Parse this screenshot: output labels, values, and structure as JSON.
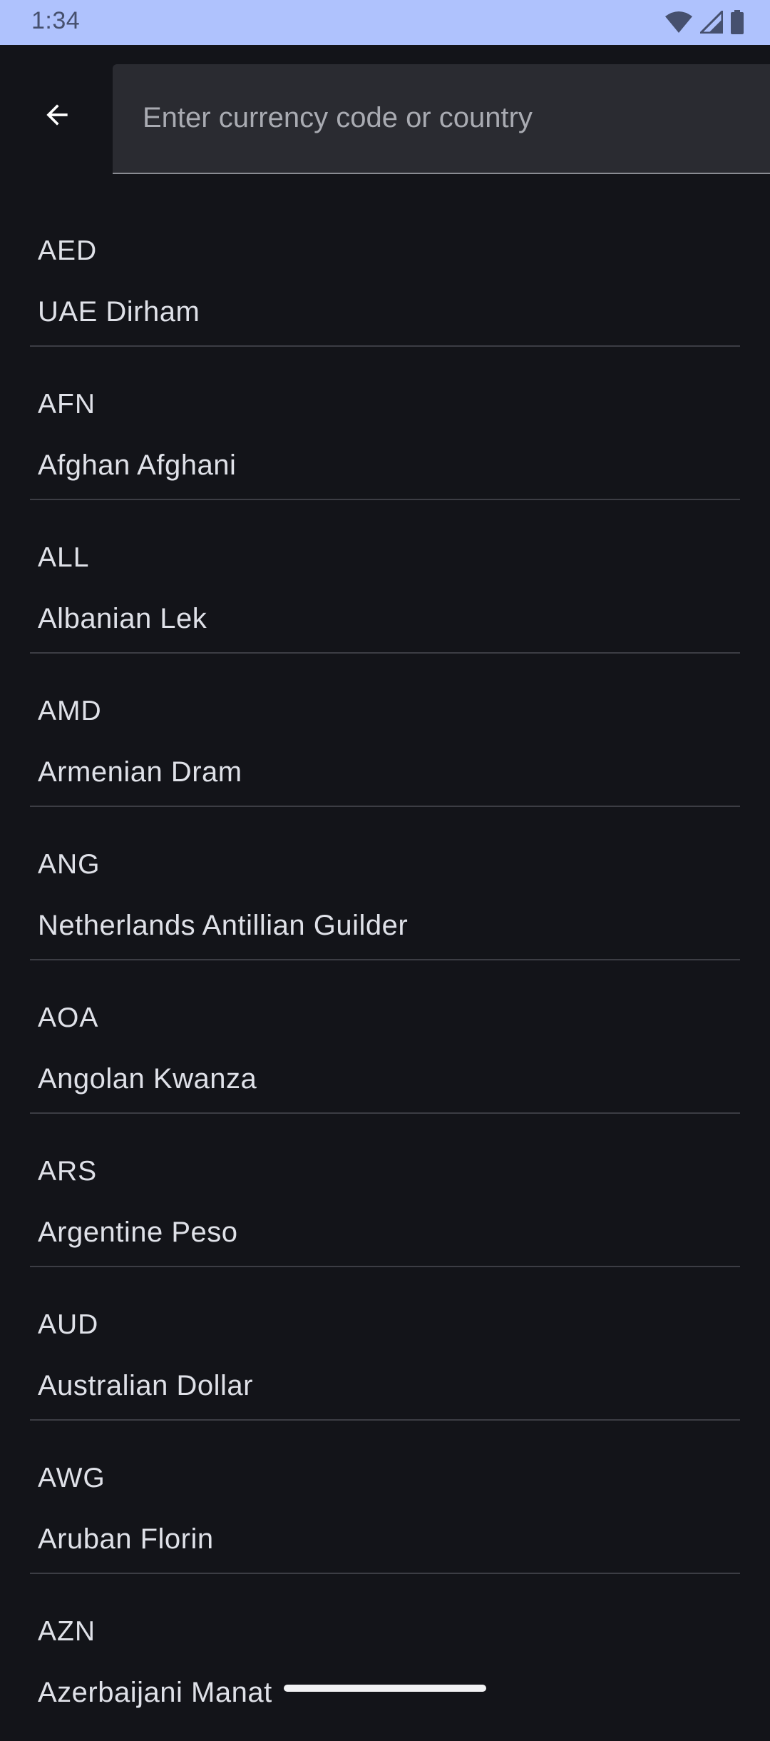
{
  "status_bar": {
    "time": "1:34",
    "icons": [
      "wifi-icon",
      "cellular-signal-icon",
      "battery-icon"
    ],
    "background": "#afc2fd"
  },
  "app_bar": {
    "back_icon": "arrow-back-icon",
    "search": {
      "value": "",
      "placeholder": "Enter currency code or country"
    }
  },
  "currencies": [
    {
      "code": "AED",
      "name": "UAE Dirham"
    },
    {
      "code": "AFN",
      "name": "Afghan Afghani"
    },
    {
      "code": "ALL",
      "name": "Albanian Lek"
    },
    {
      "code": "AMD",
      "name": "Armenian Dram"
    },
    {
      "code": "ANG",
      "name": "Netherlands Antillian Guilder"
    },
    {
      "code": "AOA",
      "name": "Angolan Kwanza"
    },
    {
      "code": "ARS",
      "name": "Argentine Peso"
    },
    {
      "code": "AUD",
      "name": "Australian Dollar"
    },
    {
      "code": "AWG",
      "name": "Aruban Florin"
    },
    {
      "code": "AZN",
      "name": "Azerbaijani Manat"
    }
  ],
  "colors": {
    "background": "#131419",
    "search_field": "#2a2b31",
    "text": "#dfe1e8",
    "divider": "#3c3d44"
  }
}
